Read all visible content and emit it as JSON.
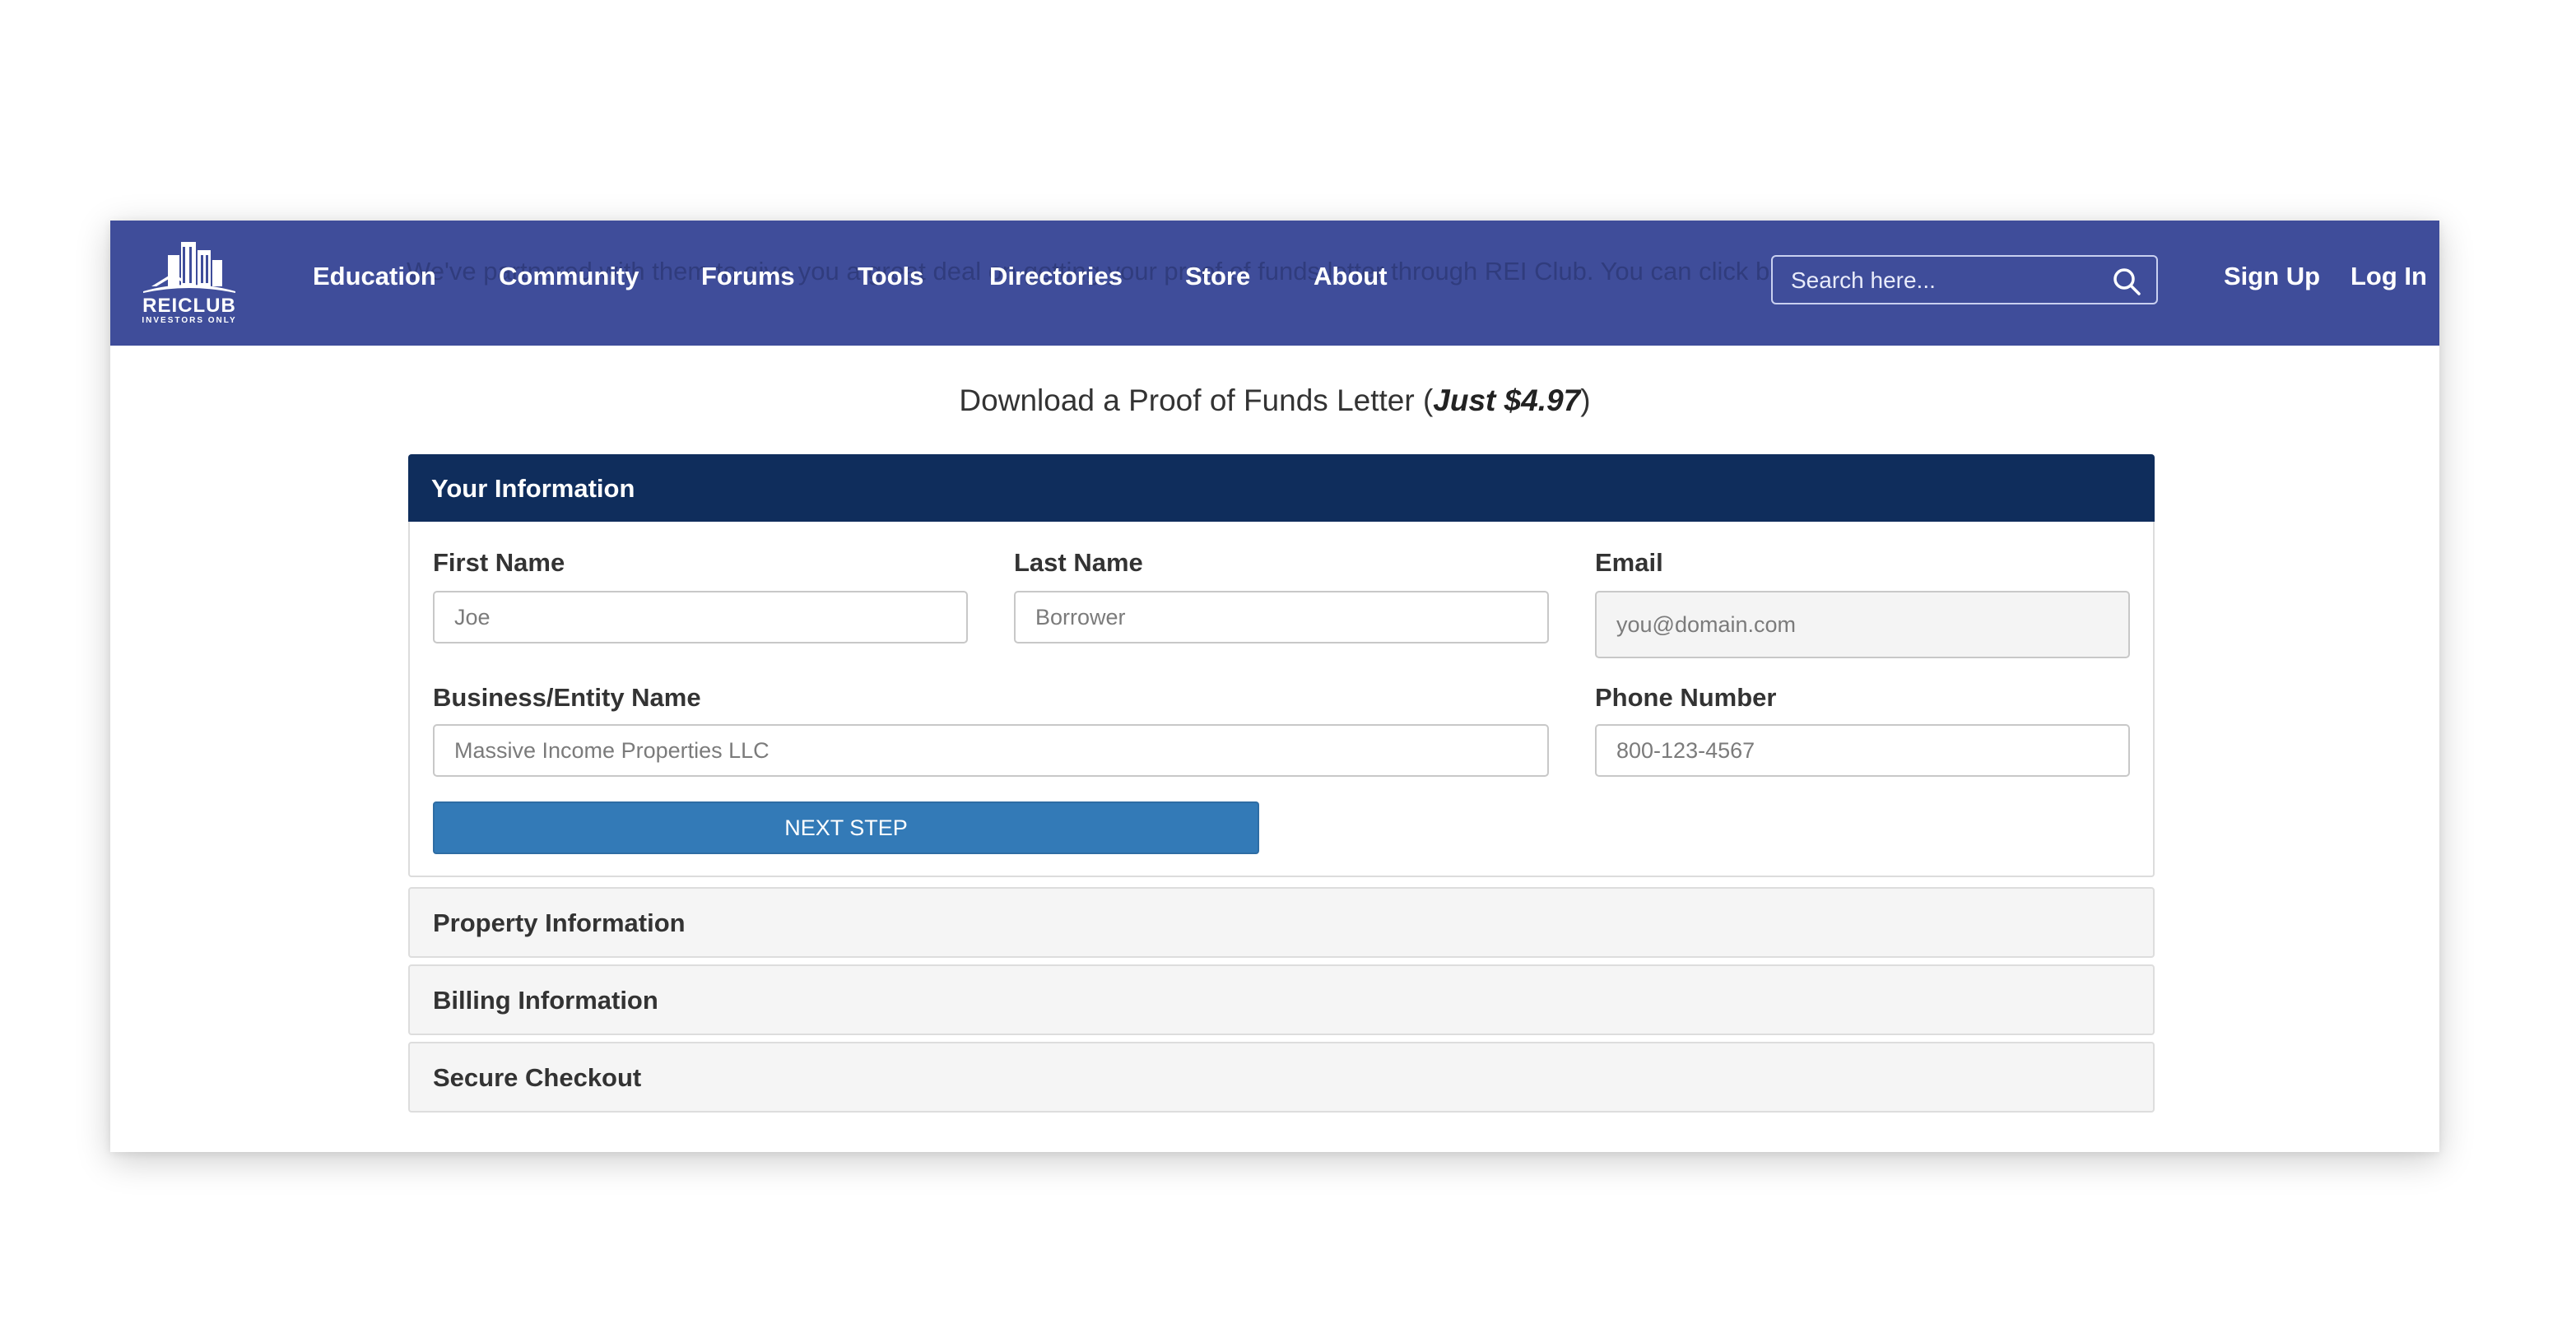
{
  "background_text": "We've partnered with them to give you a great deal on getting your proof of funds letter through REI Club. You can click below to claim yours instantly.",
  "logo": {
    "name": "REICLUB",
    "tagline": "INVESTORS ONLY"
  },
  "nav": {
    "items": [
      "Education",
      "Community",
      "Forums",
      "Tools",
      "Directories",
      "Store",
      "About"
    ],
    "sign_up": "Sign Up",
    "log_in": "Log In"
  },
  "search": {
    "placeholder": "Search here..."
  },
  "page": {
    "heading_prefix": "Download a Proof of Funds Letter (",
    "heading_price": "Just $4.97",
    "heading_suffix": ")"
  },
  "form": {
    "section_title": "Your Information",
    "first_name": {
      "label": "First Name",
      "placeholder": "Joe"
    },
    "last_name": {
      "label": "Last Name",
      "placeholder": "Borrower"
    },
    "email": {
      "label": "Email",
      "placeholder": "you@domain.com"
    },
    "business": {
      "label": "Business/Entity Name",
      "placeholder": "Massive Income Properties LLC"
    },
    "phone": {
      "label": "Phone Number",
      "placeholder": "800-123-4567"
    },
    "next_button": "NEXT STEP"
  },
  "sections": [
    "Property Information",
    "Billing Information",
    "Secure Checkout"
  ],
  "colors": {
    "nav_bg": "#3f4d9a",
    "panel_header": "#0f2d5c",
    "primary_button": "#337ab7"
  }
}
